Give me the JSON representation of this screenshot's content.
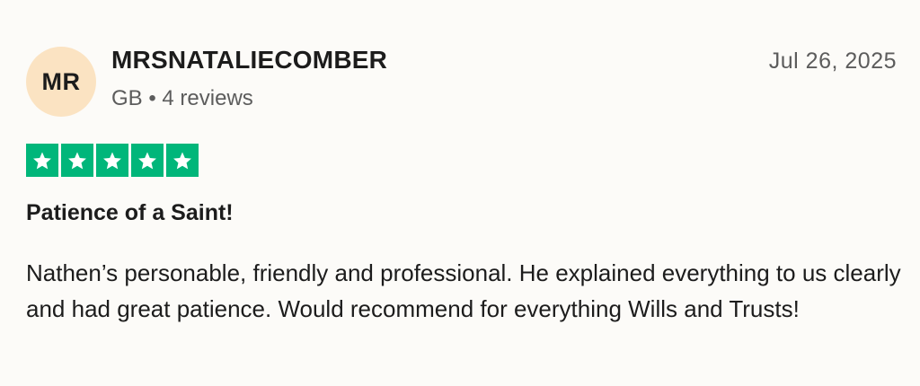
{
  "reviewer": {
    "initials": "MR",
    "name": "MRSNATALIECOMBER",
    "meta": "GB • 4 reviews",
    "avatar_color": "#fbe3c2"
  },
  "review": {
    "date": "Jul 26, 2025",
    "rating": 5,
    "rating_max": 5,
    "star_color": "#00b67a",
    "star_icon": "star-icon",
    "title": "Patience of a Saint!",
    "body": "Nathen’s personable, friendly and professional. He explained everything to us clearly and had great patience. Would recommend for everything Wills and Trusts!"
  }
}
